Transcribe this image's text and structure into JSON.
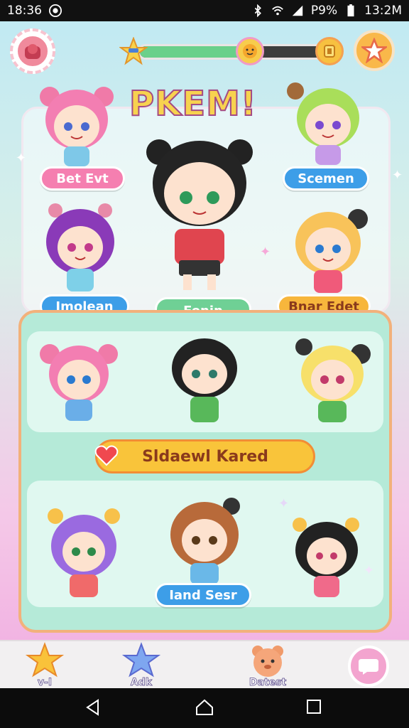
{
  "status_bar": {
    "time_left": "18:36",
    "battery_text": "P9%",
    "time_right": "13:2M"
  },
  "hud": {
    "progress_fraction": 0.6,
    "colors": {
      "track": "#3d3d3d",
      "fill": "#6ad08a"
    }
  },
  "title": "PKEM!",
  "top_labels": {
    "top_left": "Bet Evt",
    "top_right": "Scemen",
    "mid_left": "Imolean",
    "center": "Fonin",
    "mid_right": "Bnar Edet"
  },
  "banner": {
    "label": "Sldaewl Kared"
  },
  "bottom_label": "Iand Sesr",
  "nav": {
    "items": [
      {
        "label": "v-I",
        "icon": "house-star-icon"
      },
      {
        "label": "Adk",
        "icon": "star-icon"
      },
      {
        "label": "Datest",
        "icon": "bear-icon"
      }
    ],
    "right_icon": "chat-bubble-icon"
  }
}
